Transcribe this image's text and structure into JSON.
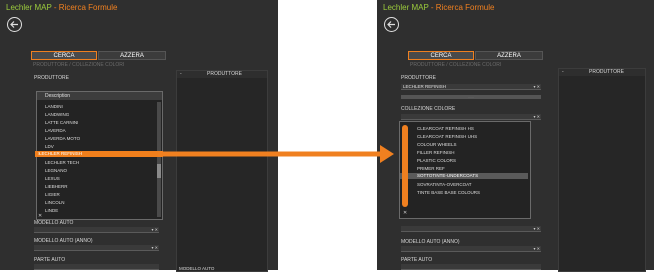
{
  "app": {
    "brand": "Lechler MAP",
    "separator": "-",
    "section": "Ricerca Formule"
  },
  "buttons": {
    "cerca": "CERCA",
    "azzera": "AZZERA"
  },
  "faint_heading": "PRODUTTORE / COLLEZIONE COLORI",
  "left": {
    "produttore_label": "PRODUTTORE",
    "dropdown_header": "Description",
    "items": [
      "LANDINI",
      "LANDWING",
      "LATTE CARNINI",
      "LAVERDA",
      "LAVERDA MOTO",
      "LDV",
      "LECHLER REFINISH",
      "LECHLER TECH",
      "LEGNANO",
      "LEXUS",
      "LIEBHERR",
      "LIGIER",
      "LINCOLN",
      "LINDE"
    ],
    "selected_index": 6,
    "selected_marker": "›",
    "close": "✕",
    "modello_auto": "MODELLO AUTO",
    "modello_auto_anno": "MODELLO AUTO (ANNO)",
    "parte_auto": "PARTE AUTO",
    "produttore_column": "PRODUTTORE",
    "column_marker": "-",
    "modello_column": "MODELLO AUTO",
    "field_arrow": "▾ ✕"
  },
  "right": {
    "produttore_label": "PRODUTTORE",
    "produttore_value": "LECHLER REFINISH",
    "collezione_label": "COLLEZIONE COLORE",
    "strip_text": "······",
    "items": [
      "CLEARCOAT REFINISH HS",
      "CLEARCOAT REFINISH UHS",
      "COLOUR WHEELS",
      "FILLER REFINISH",
      "PLASTIC COLORS",
      "PRIMER REF",
      "SOTTOTINTE-UNDERCOATS",
      "SOVRATINTA-OVERCOAT",
      "TINTE BASE BASE COLOURS"
    ],
    "selected_index": 6,
    "close": "✕",
    "modello_auto_anno": "MODELLO AUTO (ANNO)",
    "parte_auto": "PARTE AUTO",
    "produttore_column": "PRODUTTORE",
    "column_marker": "-",
    "field_arrow": "▾ ✕"
  },
  "colors": {
    "accent": "#f08020",
    "brand": "#9ccc3c",
    "panel": "#2f2f2f"
  },
  "icons": {
    "back": "back-arrow-icon"
  }
}
